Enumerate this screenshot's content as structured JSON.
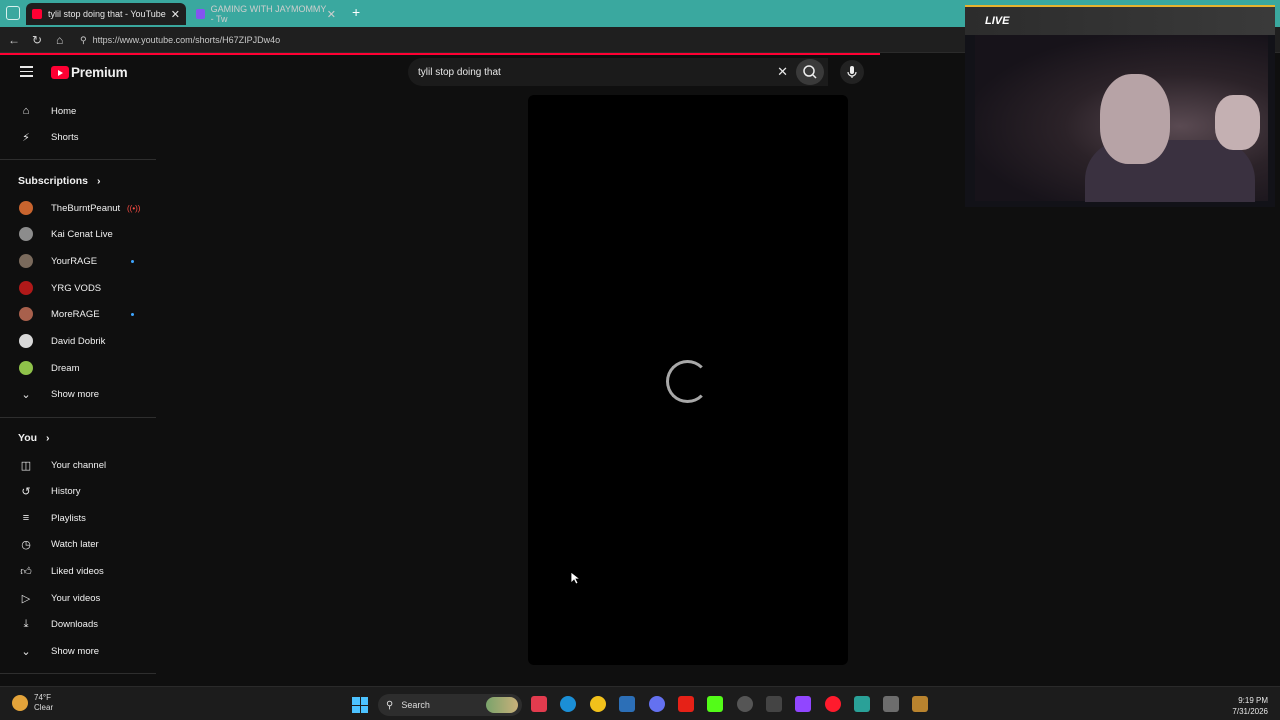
{
  "browser": {
    "tabs": [
      {
        "title": "tylil stop doing that - YouTube",
        "active": true
      },
      {
        "title": "GAMING WITH JAYMOMMY - Tw",
        "active": false
      }
    ],
    "url": "https://www.youtube.com/shorts/H67ZIPJDw4o"
  },
  "youtube": {
    "brand": "Premium",
    "search_query": "tylil stop doing that",
    "accent": "#ff0033"
  },
  "sidebar": {
    "top_items": [
      {
        "label": "Home",
        "icon": "home-icon"
      },
      {
        "label": "Shorts",
        "icon": "shorts-icon"
      }
    ],
    "subscriptions_heading": "Subscriptions",
    "subscriptions": [
      {
        "label": "TheBurntPeanut",
        "status": "live",
        "color": "#c8642e"
      },
      {
        "label": "Kai Cenat Live",
        "status": "",
        "color": "#8c8c8c"
      },
      {
        "label": "YourRAGE",
        "status": "new",
        "color": "#7a6a5c"
      },
      {
        "label": "YRG VODS",
        "status": "",
        "color": "#b01919"
      },
      {
        "label": "MoreRAGE",
        "status": "new",
        "color": "#a8604c"
      },
      {
        "label": "David Dobrik",
        "status": "",
        "color": "#d8d8d8"
      },
      {
        "label": "Dream",
        "status": "",
        "color": "#8fc24a"
      }
    ],
    "subs_show_more": "Show more",
    "you_heading": "You",
    "you_items": [
      {
        "label": "Your channel",
        "icon": "user-square-icon"
      },
      {
        "label": "History",
        "icon": "history-icon"
      },
      {
        "label": "Playlists",
        "icon": "playlist-icon"
      },
      {
        "label": "Watch later",
        "icon": "clock-icon"
      },
      {
        "label": "Liked videos",
        "icon": "thumbs-up-icon"
      },
      {
        "label": "Your videos",
        "icon": "video-icon"
      },
      {
        "label": "Downloads",
        "icon": "download-icon"
      }
    ],
    "you_show_more": "Show more"
  },
  "overlay": {
    "live_label": "LIVE"
  },
  "taskbar": {
    "weather_temp": "74°F",
    "weather_desc": "Clear",
    "search_label": "Search",
    "time": "9:19 PM",
    "date": "7/31/2026"
  }
}
